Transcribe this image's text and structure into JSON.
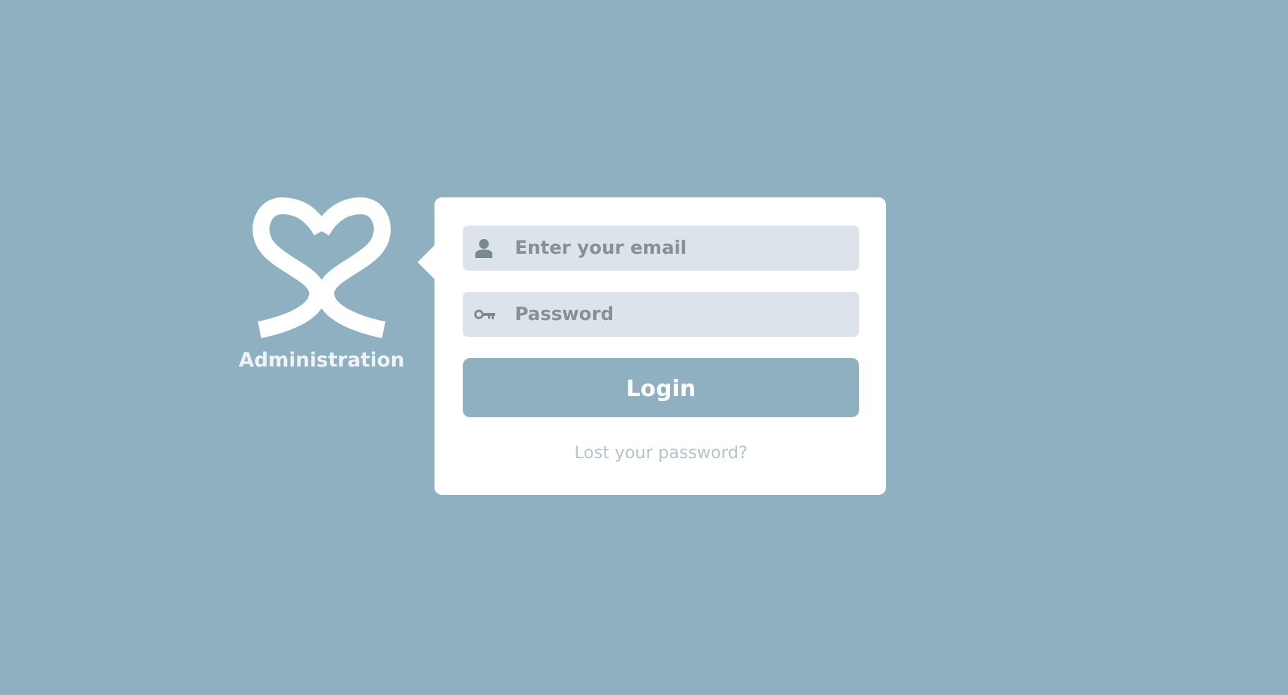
{
  "brand": {
    "label": "Administration"
  },
  "form": {
    "email": {
      "placeholder": "Enter your email"
    },
    "password": {
      "placeholder": "Password"
    },
    "submit": "Login",
    "forgot_link": "Lost your password?"
  }
}
